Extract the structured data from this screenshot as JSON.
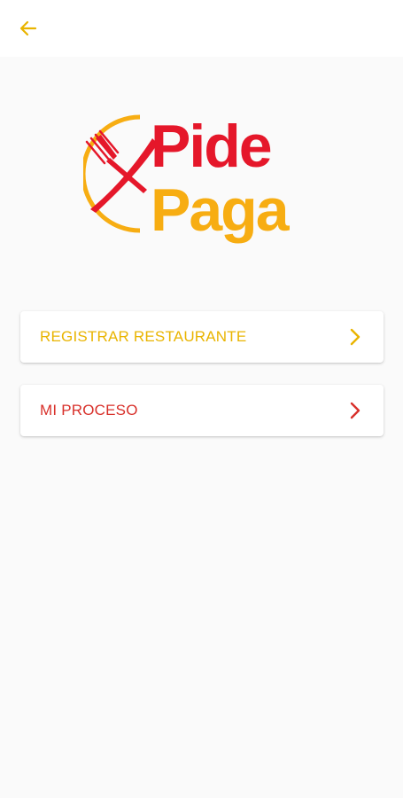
{
  "header": {
    "back_icon": "arrow-left-icon"
  },
  "logo": {
    "line1": "Pide",
    "line2": "Paga",
    "colors": {
      "red": "#e5172a",
      "yellow": "#f7ad12"
    }
  },
  "menu": {
    "items": [
      {
        "label": "REGISTRAR RESTAURANTE",
        "icon": "chevron-right-icon",
        "color": "#e9b400"
      },
      {
        "label": "MI PROCESO",
        "icon": "chevron-right-icon",
        "color": "#d8302a"
      }
    ]
  },
  "colors": {
    "background": "#fafafa",
    "topbar": "#ffffff",
    "accent_yellow": "#e9b400",
    "accent_red": "#d8302a"
  }
}
